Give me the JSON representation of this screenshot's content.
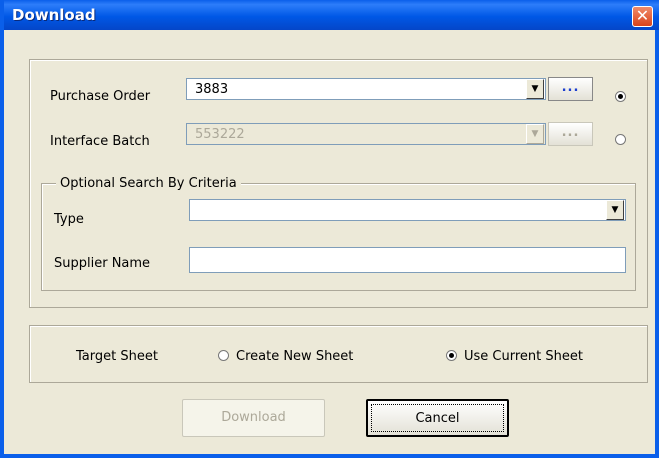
{
  "window": {
    "title": "Download",
    "close_icon": "close-icon"
  },
  "po": {
    "label": "Purchase Order",
    "value": "3883",
    "browse": "...",
    "selected": true
  },
  "batch": {
    "label": "Interface Batch",
    "value": "553222",
    "browse": "...",
    "selected": false
  },
  "criteria": {
    "legend": "Optional Search By Criteria",
    "type_label": "Type",
    "type_value": "",
    "supplier_label": "Supplier Name",
    "supplier_value": ""
  },
  "target": {
    "label": "Target Sheet",
    "option_new": "Create New Sheet",
    "option_current": "Use Current Sheet",
    "selected": "current"
  },
  "buttons": {
    "download": "Download",
    "cancel": "Cancel"
  }
}
